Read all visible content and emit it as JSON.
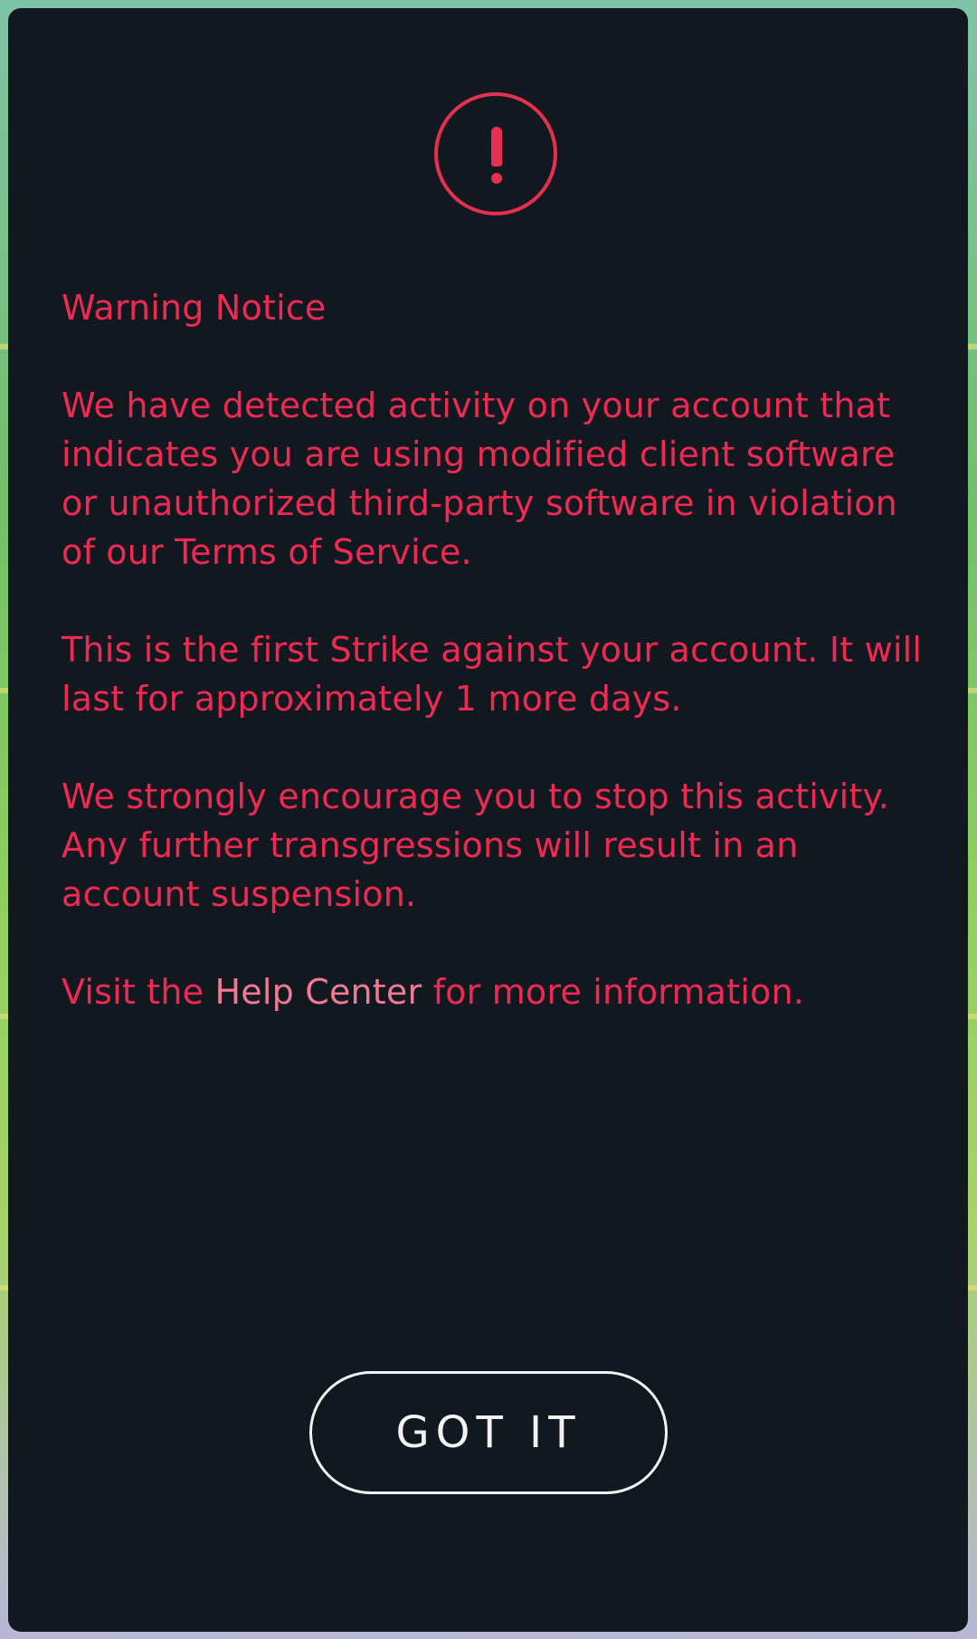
{
  "colors": {
    "dialog_background": "#121820",
    "warning_accent": "#e5304f",
    "body_text": "#ee2a52",
    "button_outline": "#f2f2f2"
  },
  "dialog": {
    "icon": "exclamation-circle-icon",
    "title": "Warning Notice",
    "paragraph_1": {
      "text": "We have detected activity on your account that indicates you are using modified client software or unauthorized third-party software in violation of our ",
      "link": "Terms of Service",
      "suffix": "."
    },
    "paragraph_2": "This is the first Strike against your account. It will last for approximately 1 more days.",
    "paragraph_3": "We strongly encourage you to stop this activity. Any further transgressions will result in an account suspension.",
    "paragraph_4": {
      "prefix": "Visit the ",
      "link": "Help Center",
      "suffix": " for more information."
    },
    "button_label": "GOT IT"
  }
}
